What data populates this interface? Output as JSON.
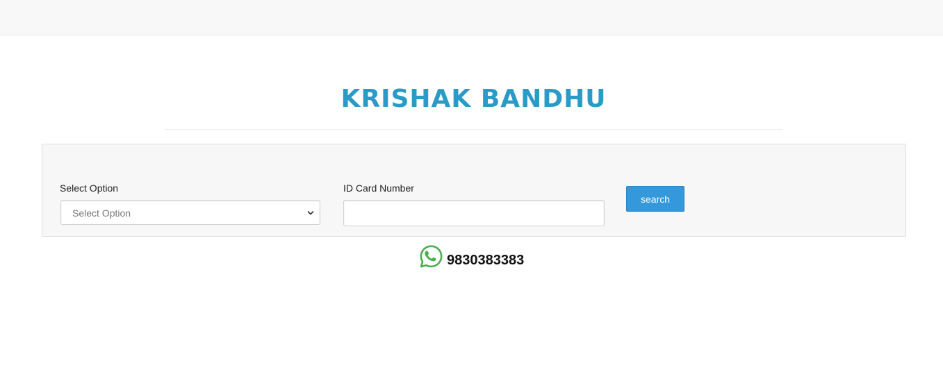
{
  "header": {
    "title": "KRISHAK BANDHU"
  },
  "form": {
    "select_label": "Select Option",
    "select_value": "Select Option",
    "id_label": "ID Card Number",
    "id_value": "",
    "search_label": "search"
  },
  "contact": {
    "icon": "whatsapp-icon",
    "phone": "9830383383"
  },
  "colors": {
    "title": "#2a9ac6",
    "button": "#3498db",
    "whatsapp": "#4caf50"
  }
}
